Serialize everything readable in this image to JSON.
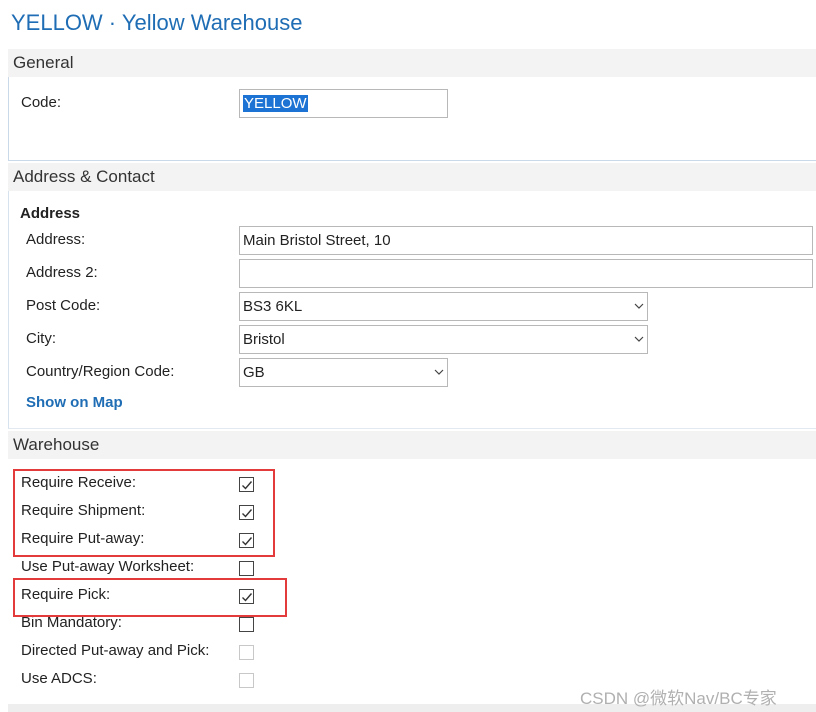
{
  "page": {
    "title": "YELLOW · Yellow Warehouse"
  },
  "general": {
    "header": "General",
    "code_label": "Code:",
    "code_value": "YELLOW"
  },
  "address_contact": {
    "header": "Address & Contact",
    "group_label": "Address",
    "address_label": "Address:",
    "address_value": "Main Bristol Street, 10",
    "address2_label": "Address 2:",
    "address2_value": "",
    "post_code_label": "Post Code:",
    "post_code_value": "BS3 6KL",
    "city_label": "City:",
    "city_value": "Bristol",
    "country_label": "Country/Region Code:",
    "country_value": "GB",
    "show_on_map": "Show on Map"
  },
  "warehouse": {
    "header": "Warehouse",
    "fields": [
      {
        "label": "Require Receive:",
        "checked": true,
        "enabled": true
      },
      {
        "label": "Require Shipment:",
        "checked": true,
        "enabled": true
      },
      {
        "label": "Require Put-away:",
        "checked": true,
        "enabled": true
      },
      {
        "label": "Use Put-away Worksheet:",
        "checked": false,
        "enabled": true
      },
      {
        "label": "Require Pick:",
        "checked": true,
        "enabled": true
      },
      {
        "label": "Bin Mandatory:",
        "checked": false,
        "enabled": true
      },
      {
        "label": "Directed Put-away and Pick:",
        "checked": false,
        "enabled": false
      },
      {
        "label": "Use ADCS:",
        "checked": false,
        "enabled": false
      }
    ]
  },
  "watermark": "CSDN @微软Nav/BC专家",
  "colors": {
    "title_blue": "#1f6db4",
    "selection_blue": "#1c73d4",
    "highlight_red": "#e33b3b",
    "section_bg": "#f3f3f3"
  }
}
